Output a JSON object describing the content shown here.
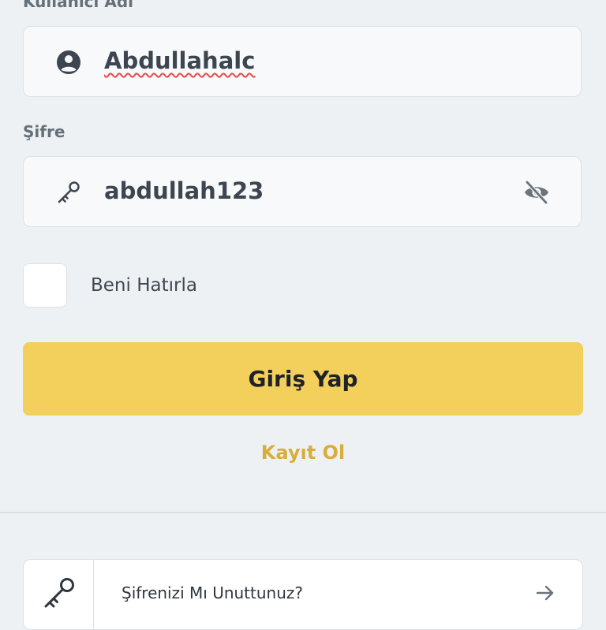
{
  "username": {
    "label": "Kullanıcı Adı",
    "value": "Abdullahalc",
    "icon": "account-circle-icon"
  },
  "password": {
    "label": "Şifre",
    "value": "abdullah123",
    "icon": "key-icon",
    "toggle_icon": "eye-off-icon"
  },
  "remember_me": {
    "label": "Beni Hatırla",
    "checked": false
  },
  "login_button": {
    "label": "Giriş Yap"
  },
  "register_link": {
    "label": "Kayıt Ol"
  },
  "forgot_password": {
    "label": "Şifrenizi Mı Unuttunuz?",
    "icon": "key-icon",
    "arrow_icon": "arrow-right-icon"
  },
  "colors": {
    "background": "#eef1f3",
    "primary_button": "#f3cf5c",
    "link": "#d9ad3c",
    "label_text": "#66707a",
    "input_text": "#3c4550",
    "spellcheck_underline": "#e64a4a"
  }
}
